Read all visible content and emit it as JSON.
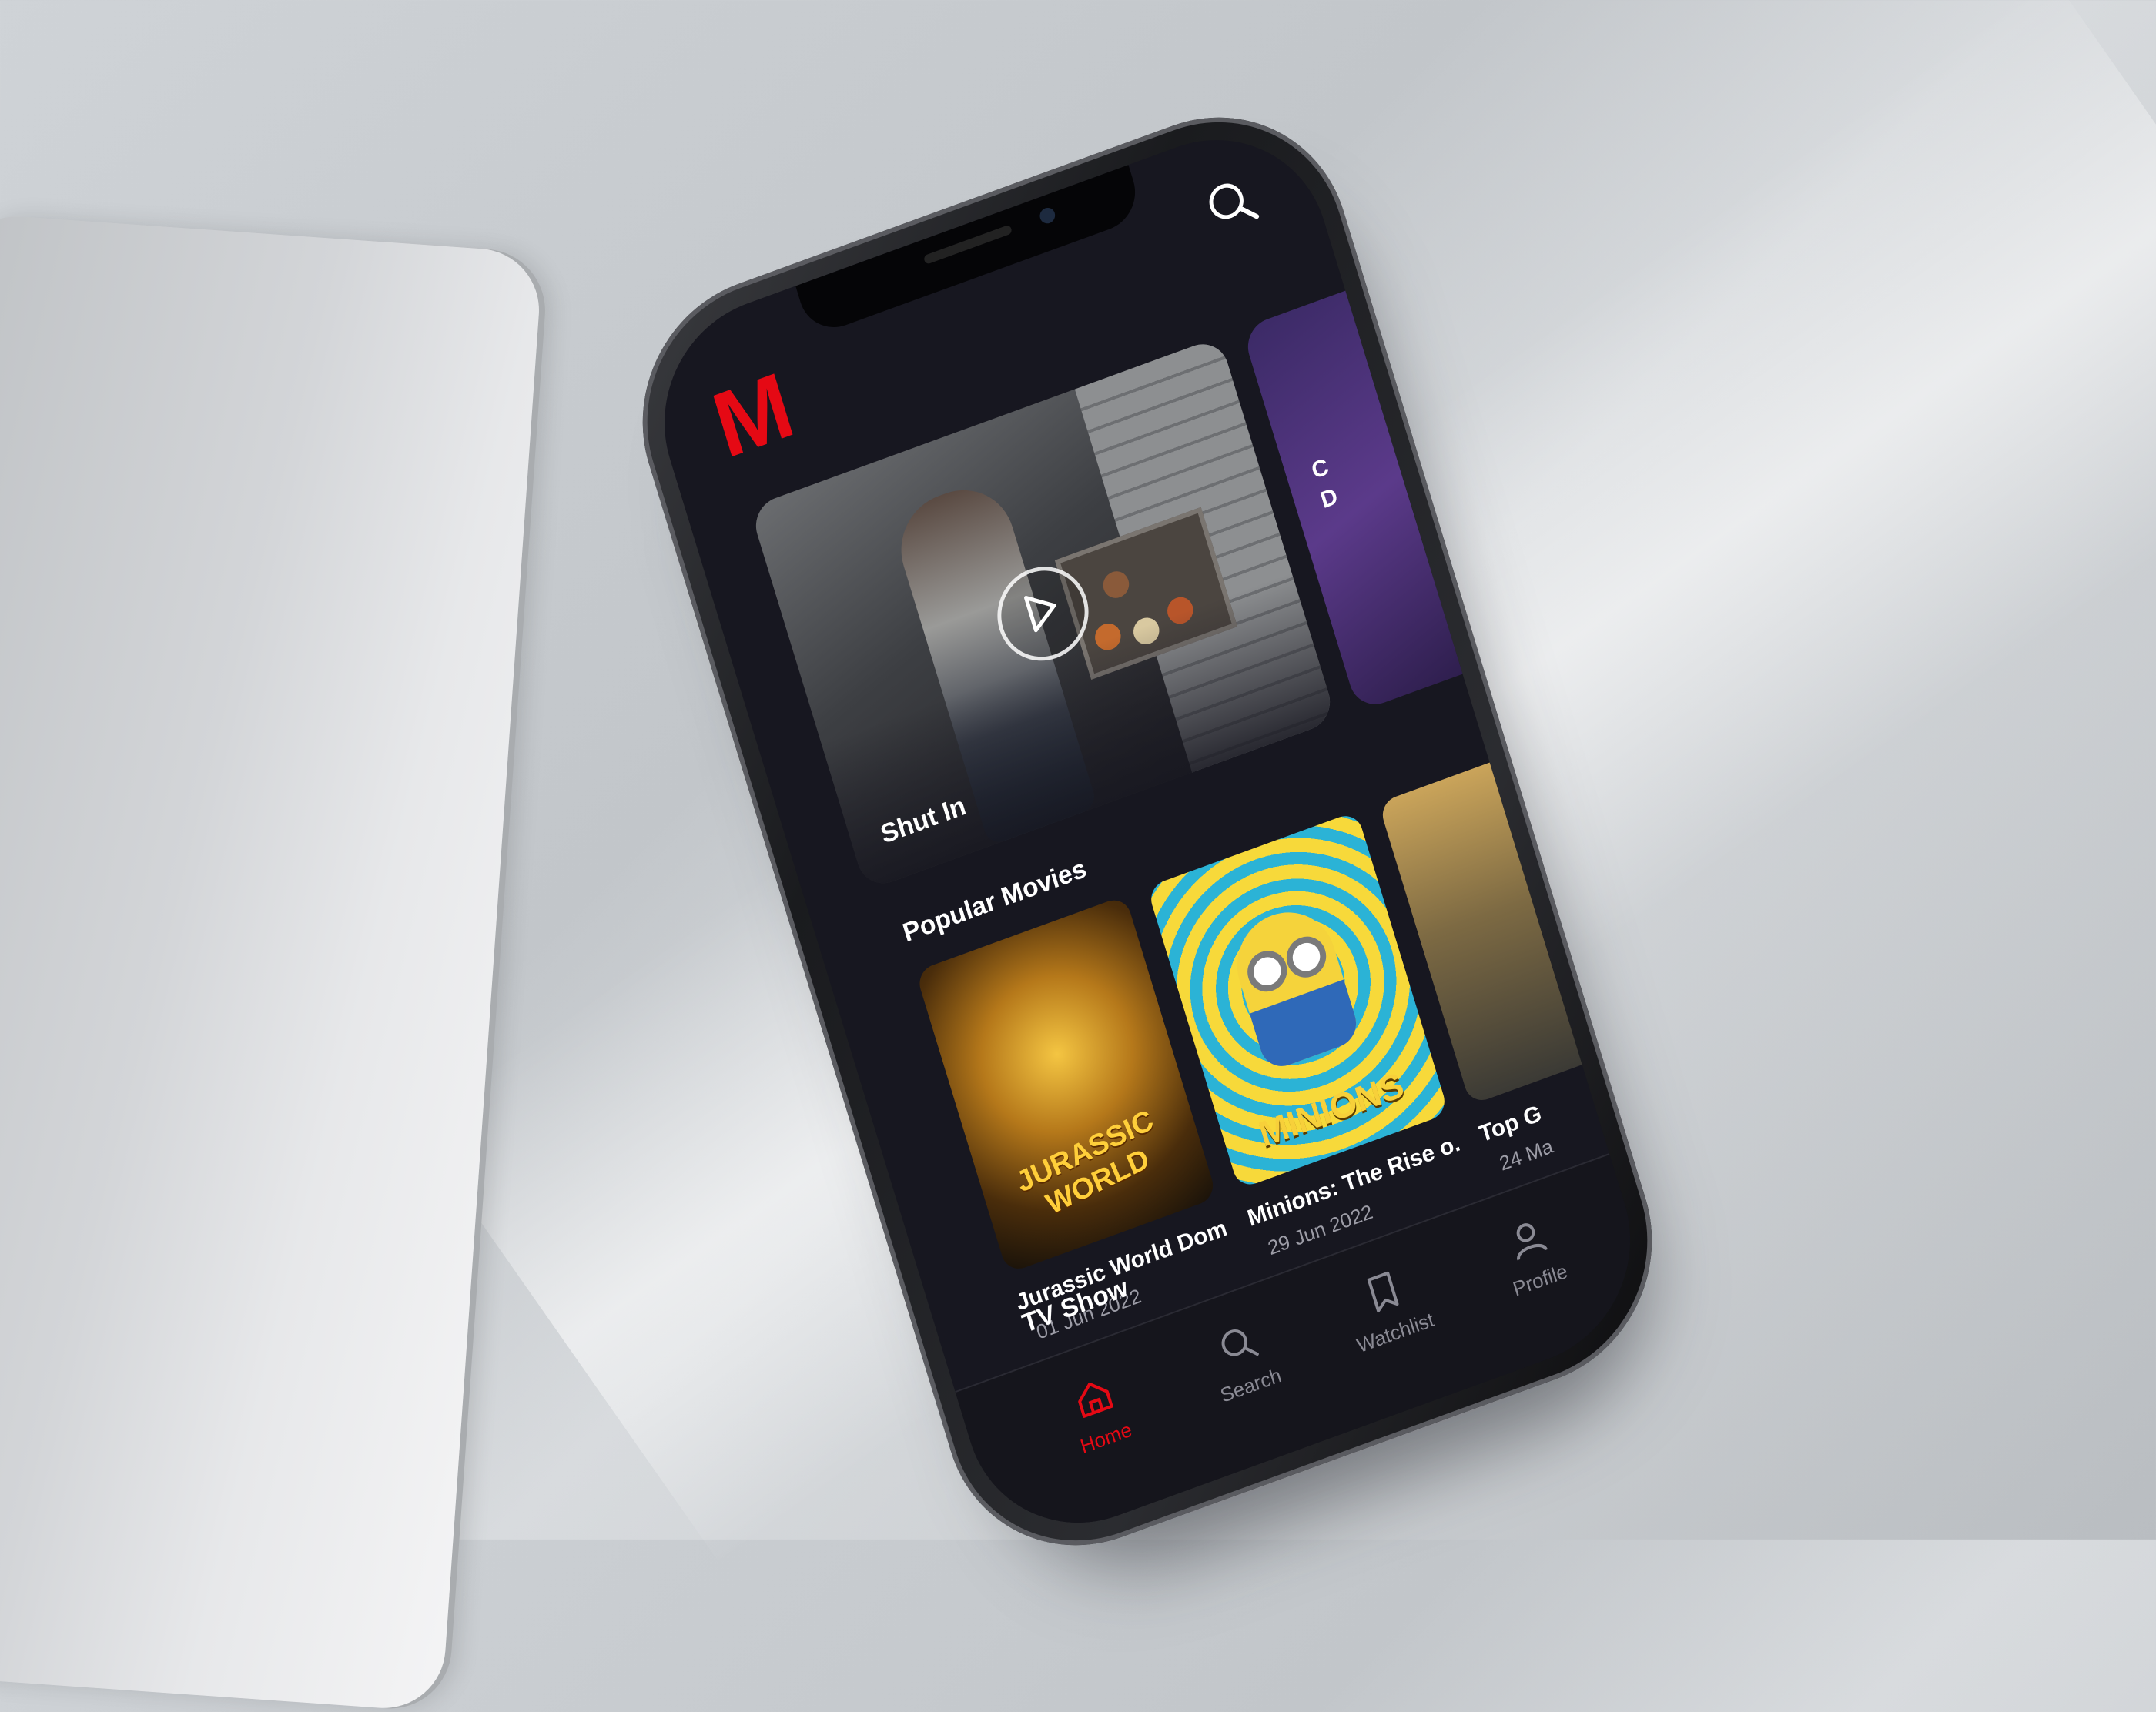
{
  "app": {
    "logo": "M",
    "accent_color": "#e50914",
    "background_color": "#171720"
  },
  "header": {
    "search_icon": "search-icon"
  },
  "hero": {
    "title": "Shut In",
    "play_icon": "play-icon",
    "next_peek_text": [
      "C",
      "D"
    ]
  },
  "popular_movies": {
    "title": "Popular Movies",
    "items": [
      {
        "title": "Jurassic World Dom...",
        "date": "01 Jun 2022",
        "poster_text": "JURASSIC WORLD"
      },
      {
        "title": "Minions: The Rise o...",
        "date": "29 Jun 2022",
        "poster_text": "MINIONS"
      },
      {
        "title": "Top G",
        "date": "24 Ma"
      }
    ]
  },
  "tv_show": {
    "title": "TV Show"
  },
  "nav": {
    "items": [
      {
        "label": "Home",
        "icon": "home-icon",
        "active": true
      },
      {
        "label": "Search",
        "icon": "search-icon",
        "active": false
      },
      {
        "label": "Watchlist",
        "icon": "bookmark-icon",
        "active": false
      },
      {
        "label": "Profile",
        "icon": "person-icon",
        "active": false
      }
    ]
  }
}
